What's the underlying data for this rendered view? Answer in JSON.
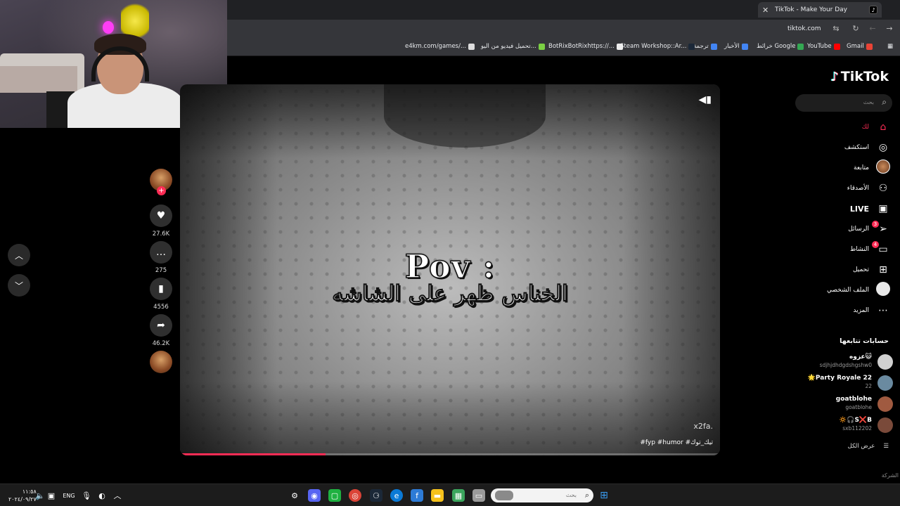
{
  "browser": {
    "tab_title": "TikTok - Make Your Day",
    "tab_close": "✕",
    "new_tab": "+",
    "url": "tiktok.com",
    "bookmarks": [
      {
        "label": "Gmail",
        "color": "#ea4335"
      },
      {
        "label": "YouTube",
        "color": "#ff0000"
      },
      {
        "label": "خرائط Google",
        "color": "#34a853"
      },
      {
        "label": "الأخبار",
        "color": "#4285f4"
      },
      {
        "label": "ترجمة",
        "color": "#4285f4"
      },
      {
        "label": "Steam Workshop::Ar...",
        "color": "#1b2838"
      },
      {
        "label": "BotRixBotRixhttps://...",
        "color": "#eeeeee"
      },
      {
        "label": "تحميل فيديو من اليو...",
        "color": "#7bd043"
      },
      {
        "label": "e4km.com/games/...",
        "color": "#dddddd"
      }
    ]
  },
  "video": {
    "pov_text": "Pov :",
    "arabic_caption": "الخناس ظهر على الشاشه",
    "watermark": "x2fa.",
    "hashtags": "#fyp #humor #تيك_توك",
    "progress_percent": 27
  },
  "actions": {
    "likes": "27.6K",
    "comments": "275",
    "saves": "4556",
    "shares": "46.2K"
  },
  "sidebar": {
    "logo": "TikTok",
    "search_placeholder": "بحث",
    "nav": [
      {
        "label": "لك",
        "icon": "home-icon",
        "active": true
      },
      {
        "label": "استكشف",
        "icon": "compass-icon"
      },
      {
        "label": "متابعة",
        "icon": "following-icon"
      },
      {
        "label": "الأصدقاء",
        "icon": "friends-icon"
      },
      {
        "label": "LIVE",
        "icon": "live-icon"
      },
      {
        "label": "الرسائل",
        "icon": "messages-icon",
        "badge": "3"
      },
      {
        "label": "النشاط",
        "icon": "activity-icon",
        "badge": "4"
      },
      {
        "label": "تحميل",
        "icon": "upload-icon"
      },
      {
        "label": "الملف الشخصي",
        "icon": "profile-icon"
      },
      {
        "label": "المزيد",
        "icon": "more-icon"
      }
    ],
    "following_title": "حسابات تتابعها",
    "following": [
      {
        "name": "عزوه😺",
        "handle": "sdjhjdhdgdshgshw0",
        "color": "#d0d0d0"
      },
      {
        "name": "🌟Party Royale 22",
        "handle": "22",
        "color": "#6a8aa0"
      },
      {
        "name": "goatblohe",
        "handle": "goatblohe",
        "color": "#a05a40"
      },
      {
        "name": "🔅🎧S❌B",
        "handle": "sxb112202",
        "color": "#7a4a3a"
      }
    ],
    "see_all": "عرض الكل",
    "company": "الشركة"
  },
  "taskbar": {
    "time": "١١:٥٨",
    "date": "٢٠٢٤/٠٩/٢٧",
    "lang": "ENG",
    "search_placeholder": "بحث"
  }
}
